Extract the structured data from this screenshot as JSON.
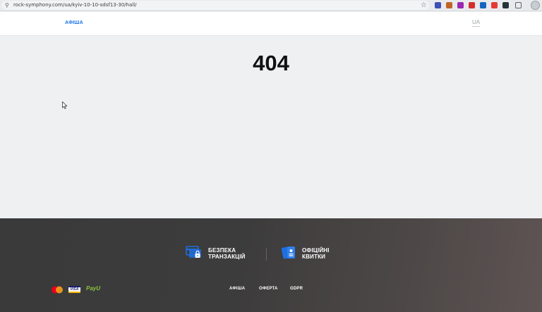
{
  "browser": {
    "url": "rock-symphony.com/ua/kyiv-10-10-sdsf13-30/hall/",
    "extensions": [
      {
        "name": "checklist-ext-icon",
        "color": "#3f51b5"
      },
      {
        "name": "circle-ext-icon",
        "color": "#c0632b"
      },
      {
        "name": "puzzle-ext-icon",
        "color": "#9c27b0"
      },
      {
        "name": "video-ext-icon",
        "color": "#d32f2f"
      },
      {
        "name": "grid-ext-icon",
        "color": "#1565c0"
      },
      {
        "name": "ring-ext-icon",
        "color": "#e53935"
      },
      {
        "name": "record-ext-icon",
        "color": "#263238"
      },
      {
        "name": "extensions-puzzle-icon",
        "color": "#5f6368"
      }
    ]
  },
  "header": {
    "nav_afisha": "АФІША",
    "language": "UA"
  },
  "main": {
    "error_code": "404"
  },
  "footer": {
    "feature_security": {
      "line1": "БЕЗПЕКА",
      "line2": "ТРАНЗАКЦІЙ"
    },
    "feature_official": {
      "line1": "ОФІЦІЙНІ",
      "line2": "КВИТКИ"
    },
    "payments": {
      "visa": "VISA",
      "payu": "PayU"
    },
    "links": {
      "afisha": "АФІША",
      "oferta": "ОФЕРТА",
      "gdpr": "GDPR"
    },
    "accent_color": "#1e6fe0"
  }
}
